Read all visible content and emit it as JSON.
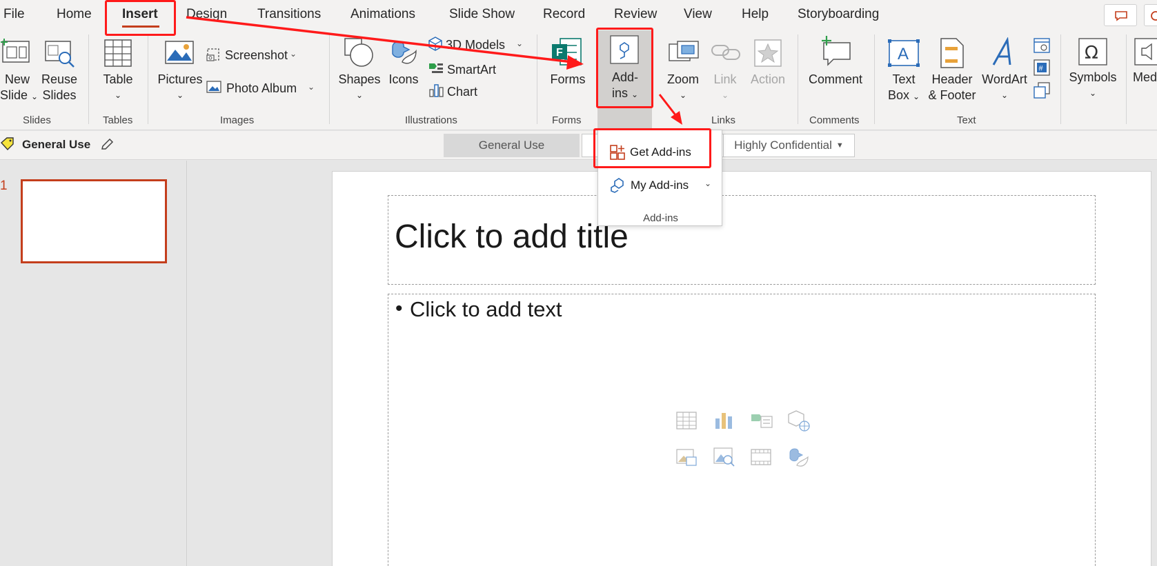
{
  "menu": {
    "file": "File",
    "home": "Home",
    "insert": "Insert",
    "design": "Design",
    "transitions": "Transitions",
    "animations": "Animations",
    "slide_show": "Slide Show",
    "record": "Record",
    "review": "Review",
    "view": "View",
    "help": "Help",
    "storyboarding": "Storyboarding"
  },
  "ribbon": {
    "new_slide": [
      "New",
      "Slide"
    ],
    "reuse_slides": [
      "Reuse",
      "Slides"
    ],
    "table": "Table",
    "pictures": "Pictures",
    "screenshot": "Screenshot",
    "photo_album": "Photo Album",
    "shapes": "Shapes",
    "icons": "Icons",
    "models_3d": "3D Models",
    "smartart": "SmartArt",
    "chart": "Chart",
    "forms": "Forms",
    "addins": [
      "Add-",
      "ins"
    ],
    "zoom": "Zoom",
    "link": "Link",
    "action": "Action",
    "comment": "Comment",
    "text_box": [
      "Text",
      "Box"
    ],
    "header_footer": [
      "Header",
      "& Footer"
    ],
    "wordart": "WordArt",
    "symbols": "Symbols",
    "media": "Med",
    "groups": {
      "slides": "Slides",
      "tables": "Tables",
      "images": "Images",
      "illustrations": "Illustrations",
      "forms": "Forms",
      "links": "Links",
      "comments": "Comments",
      "text": "Text"
    }
  },
  "sensitivity": {
    "current_label": "General Use",
    "options": [
      "General Use",
      "Highly Confidential"
    ]
  },
  "thumbs": {
    "slide_number": "1"
  },
  "slide": {
    "title_placeholder": "Click to add title",
    "body_placeholder": "Click to add text",
    "bullet": "•"
  },
  "dropdown": {
    "get_addins": "Get Add-ins",
    "my_addins": "My Add-ins",
    "section_label": "Add-ins"
  },
  "colors": {
    "accent": "#c43e1c",
    "annotation_red": "#ff1a1a",
    "icon_blue": "#2b6cb8"
  }
}
